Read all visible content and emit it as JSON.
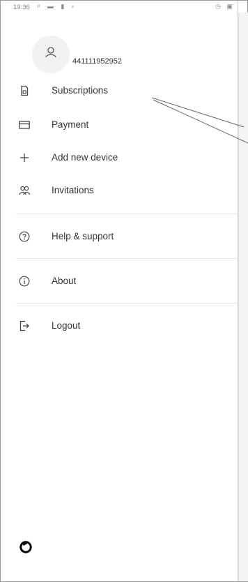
{
  "status_bar": {
    "time": "19:36",
    "left_icons": "ᵖ ▬ ▮ ⸗",
    "right_icons": "◷ ▣"
  },
  "user": {
    "id": "441111952952",
    "avatar_icon": "person-icon"
  },
  "menu": {
    "items": [
      {
        "label": "Subscriptions",
        "icon": "sim-card-icon"
      },
      {
        "label": "Payment",
        "icon": "credit-card-icon"
      },
      {
        "label": "Add new device",
        "icon": "plus-icon"
      },
      {
        "label": "Invitations",
        "icon": "people-icon"
      },
      {
        "label": "Help & support",
        "icon": "help-circle-icon"
      },
      {
        "label": "About",
        "icon": "info-circle-icon"
      },
      {
        "label": "Logout",
        "icon": "logout-icon"
      }
    ]
  },
  "brand": {
    "logo_icon": "vodafone-logo",
    "color": "#000000"
  },
  "colors": {
    "text": "#333333",
    "icon": "#444444",
    "divider": "#e6e6e6"
  }
}
